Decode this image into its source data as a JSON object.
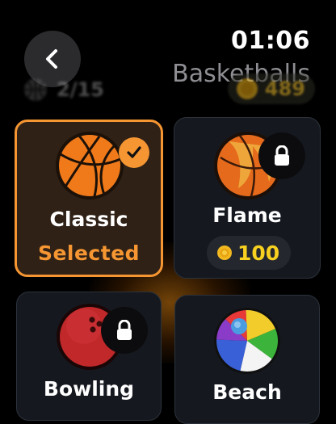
{
  "header": {
    "back_icon": "chevron-left-icon",
    "time": "01:06",
    "title": "Basketballs"
  },
  "stats": {
    "collected": "2/15",
    "coins": "489"
  },
  "balls": [
    {
      "name": "Classic",
      "status": "Selected",
      "selected": true,
      "locked": false,
      "icon": "basketball-icon"
    },
    {
      "name": "Flame",
      "price": "100",
      "selected": false,
      "locked": true,
      "icon": "flame-ball-icon"
    },
    {
      "name": "Bowling",
      "selected": false,
      "locked": true,
      "icon": "bowling-ball-icon"
    },
    {
      "name": "Beach",
      "selected": false,
      "locked": false,
      "icon": "beach-ball-icon"
    }
  ],
  "colors": {
    "accent": "#F59632",
    "coin": "#F8D020",
    "background": "#000000",
    "card": "#15191F"
  }
}
